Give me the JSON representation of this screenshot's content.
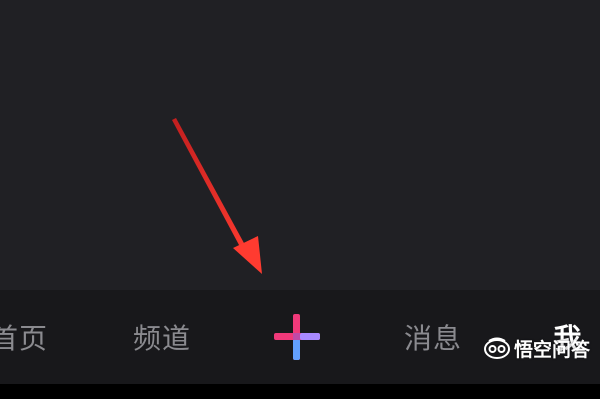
{
  "tab_bar": {
    "tabs": [
      {
        "label": "首页",
        "active": false
      },
      {
        "label": "频道",
        "active": false
      },
      {
        "icon": "plus-create-icon"
      },
      {
        "label": "消息",
        "active": false
      },
      {
        "label": "我",
        "active": true
      }
    ]
  },
  "annotation": {
    "arrow_icon": "red-arrow-icon",
    "arrow_color": "#e8302f"
  },
  "watermark": {
    "text": "悟空问答",
    "icon": "wukong-logo-icon"
  },
  "colors": {
    "background": "#202024",
    "tab_bar": "#18181b",
    "inactive_text": "#8a8a8f",
    "active_text": "#ffffff",
    "plus_pink": "#f0397a",
    "plus_blue": "#62a0ff",
    "plus_purple": "#a889ff"
  }
}
